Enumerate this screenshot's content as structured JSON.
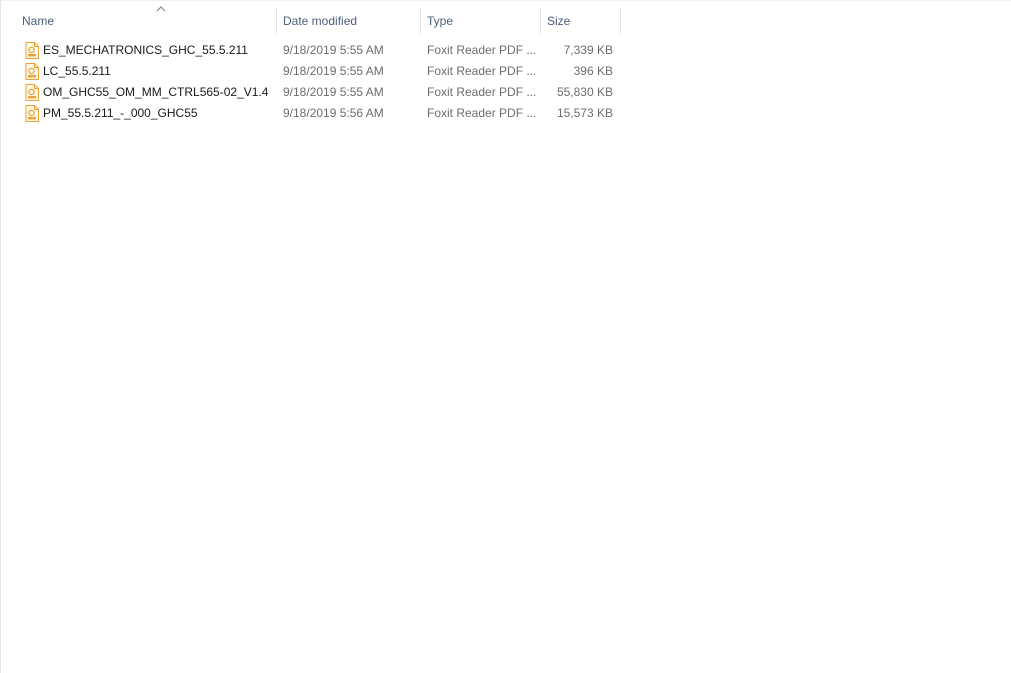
{
  "columns": {
    "name": "Name",
    "date": "Date modified",
    "type": "Type",
    "size": "Size"
  },
  "sort": {
    "column": "name",
    "direction": "ascending"
  },
  "files": [
    {
      "name": "ES_MECHATRONICS_GHC_55.5.211",
      "date": "9/18/2019 5:55 AM",
      "type": "Foxit Reader PDF ...",
      "size": "7,339 KB",
      "icon": "foxit-pdf-file-icon"
    },
    {
      "name": "LC_55.5.211",
      "date": "9/18/2019 5:55 AM",
      "type": "Foxit Reader PDF ...",
      "size": "396 KB",
      "icon": "foxit-pdf-file-icon"
    },
    {
      "name": "OM_GHC55_OM_MM_CTRL565-02_V1.4",
      "date": "9/18/2019 5:55 AM",
      "type": "Foxit Reader PDF ...",
      "size": "55,830 KB",
      "icon": "foxit-pdf-file-icon"
    },
    {
      "name": "PM_55.5.211_-_000_GHC55",
      "date": "9/18/2019 5:56 AM",
      "type": "Foxit Reader PDF ...",
      "size": "15,573 KB",
      "icon": "foxit-pdf-file-icon"
    }
  ],
  "colors": {
    "header_text": "#4c607a",
    "detail_text": "#6d6d6d",
    "icon_accent": "#e8a33a",
    "icon_body": "#fff7e6"
  }
}
